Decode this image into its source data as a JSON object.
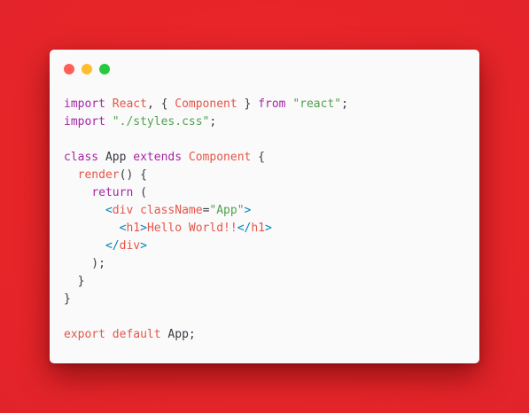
{
  "window": {
    "controls": [
      {
        "name": "close",
        "color": "#ff5f56"
      },
      {
        "name": "minimize",
        "color": "#ffbd2e"
      },
      {
        "name": "maximize",
        "color": "#27c93f"
      }
    ]
  },
  "code": {
    "lines": [
      [
        {
          "t": "import",
          "c": "kw"
        },
        {
          "t": " ",
          "c": "plain"
        },
        {
          "t": "React",
          "c": "cls"
        },
        {
          "t": ", { ",
          "c": "punc"
        },
        {
          "t": "Component",
          "c": "cls"
        },
        {
          "t": " } ",
          "c": "punc"
        },
        {
          "t": "from",
          "c": "kw"
        },
        {
          "t": " ",
          "c": "plain"
        },
        {
          "t": "\"react\"",
          "c": "str"
        },
        {
          "t": ";",
          "c": "punc"
        }
      ],
      [
        {
          "t": "import",
          "c": "kw"
        },
        {
          "t": " ",
          "c": "plain"
        },
        {
          "t": "\"./styles.css\"",
          "c": "str"
        },
        {
          "t": ";",
          "c": "punc"
        }
      ],
      [],
      [
        {
          "t": "class",
          "c": "kw"
        },
        {
          "t": " App ",
          "c": "plain"
        },
        {
          "t": "extends",
          "c": "kw"
        },
        {
          "t": " ",
          "c": "plain"
        },
        {
          "t": "Component",
          "c": "cls"
        },
        {
          "t": " {",
          "c": "punc"
        }
      ],
      [
        {
          "t": "  ",
          "c": "plain"
        },
        {
          "t": "render",
          "c": "fn"
        },
        {
          "t": "() {",
          "c": "punc"
        }
      ],
      [
        {
          "t": "    ",
          "c": "plain"
        },
        {
          "t": "return",
          "c": "kw"
        },
        {
          "t": " (",
          "c": "punc"
        }
      ],
      [
        {
          "t": "      ",
          "c": "plain"
        },
        {
          "t": "<",
          "c": "brk"
        },
        {
          "t": "div",
          "c": "tag"
        },
        {
          "t": " ",
          "c": "plain"
        },
        {
          "t": "className",
          "c": "cls"
        },
        {
          "t": "=",
          "c": "punc"
        },
        {
          "t": "\"App\"",
          "c": "str"
        },
        {
          "t": ">",
          "c": "brk"
        }
      ],
      [
        {
          "t": "        ",
          "c": "plain"
        },
        {
          "t": "<",
          "c": "brk"
        },
        {
          "t": "h1",
          "c": "tag"
        },
        {
          "t": ">",
          "c": "brk"
        },
        {
          "t": "Hello World!!",
          "c": "cls"
        },
        {
          "t": "</",
          "c": "brk"
        },
        {
          "t": "h1",
          "c": "tag"
        },
        {
          "t": ">",
          "c": "brk"
        }
      ],
      [
        {
          "t": "      ",
          "c": "plain"
        },
        {
          "t": "</",
          "c": "brk"
        },
        {
          "t": "div",
          "c": "tag"
        },
        {
          "t": ">",
          "c": "brk"
        }
      ],
      [
        {
          "t": "    );",
          "c": "punc"
        }
      ],
      [
        {
          "t": "  }",
          "c": "punc"
        }
      ],
      [
        {
          "t": "}",
          "c": "punc"
        }
      ],
      [],
      [
        {
          "t": "export",
          "c": "kw2"
        },
        {
          "t": " ",
          "c": "plain"
        },
        {
          "t": "default",
          "c": "kw2"
        },
        {
          "t": " App;",
          "c": "plain"
        }
      ]
    ]
  }
}
